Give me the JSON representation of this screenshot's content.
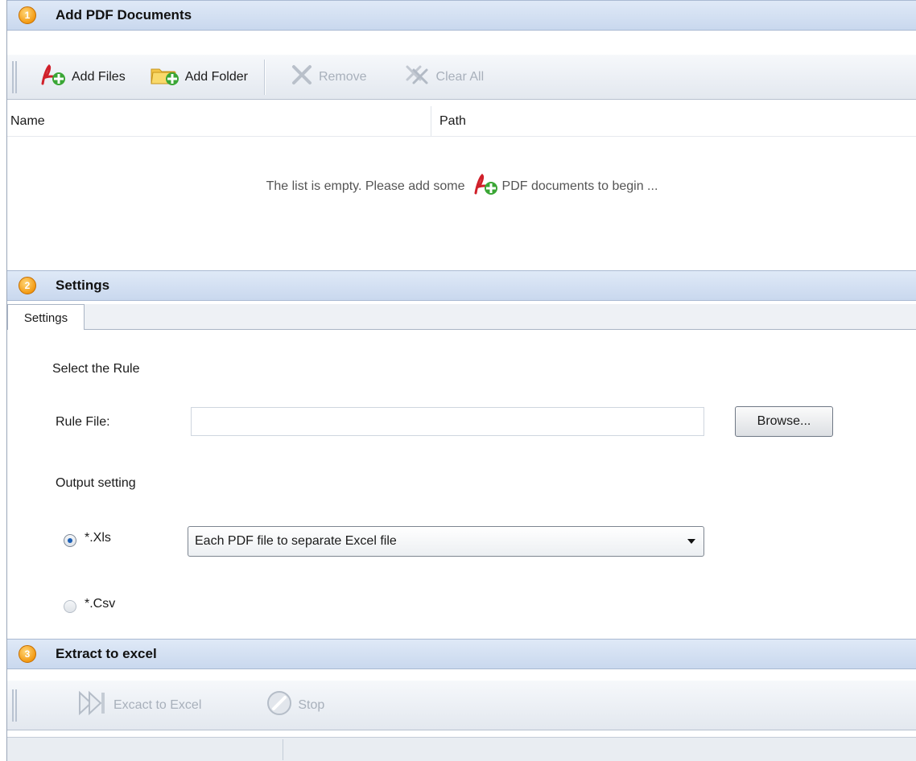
{
  "section1": {
    "number": "1",
    "title": "Add PDF Documents",
    "toolbar": {
      "add_files": "Add Files",
      "add_folder": "Add Folder",
      "remove": "Remove",
      "clear_all": "Clear All"
    },
    "list": {
      "columns": [
        "Name",
        "Path"
      ],
      "empty_before": "The list is empty. Please add some",
      "empty_after": "PDF documents to begin ..."
    }
  },
  "section2": {
    "number": "2",
    "title": "Settings",
    "tab": "Settings",
    "select_rule": "Select the Rule",
    "rule_file_label": "Rule File:",
    "rule_file_value": "",
    "browse": "Browse...",
    "output_setting": "Output setting",
    "xls_label": "*.Xls",
    "xls_selected": true,
    "xls_option": "Each PDF file to separate Excel file",
    "csv_label": "*.Csv"
  },
  "section3": {
    "number": "3",
    "title": "Extract to excel",
    "toolbar": {
      "extract": "Excact to Excel",
      "stop": "Stop"
    }
  },
  "icons": {
    "add_files": "pdf-add-icon",
    "add_folder": "folder-add-icon",
    "remove": "remove-icon",
    "clear_all": "clear-all-icon",
    "extract": "extract-icon",
    "stop": "stop-icon"
  },
  "colors": {
    "accent_badge": "#f39a13",
    "header_bg": "#c9d8ee",
    "pdf_red": "#d0202a",
    "plus_green": "#3aa635"
  }
}
